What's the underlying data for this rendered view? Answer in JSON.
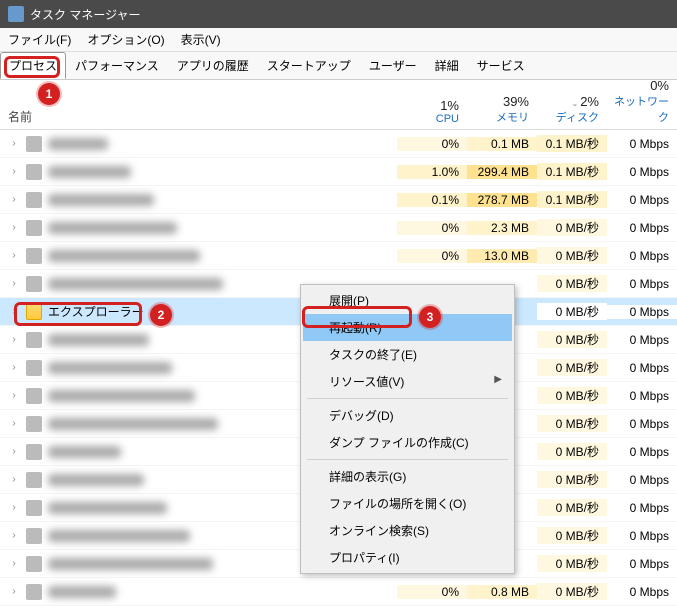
{
  "titlebar": {
    "title": "タスク マネージャー"
  },
  "menubar": {
    "file": "ファイル(F)",
    "options": "オプション(O)",
    "view": "表示(V)"
  },
  "tabs": {
    "processes": "プロセス",
    "performance": "パフォーマンス",
    "appHistory": "アプリの履歴",
    "startup": "スタートアップ",
    "users": "ユーザー",
    "details": "詳細",
    "services": "サービス"
  },
  "headers": {
    "name": "名前",
    "cpu": {
      "pct": "1%",
      "label": "CPU"
    },
    "memory": {
      "pct": "39%",
      "label": "メモリ"
    },
    "disk": {
      "pct": "2%",
      "label": "ディスク"
    },
    "network": {
      "pct": "0%",
      "label": "ネットワーク"
    }
  },
  "rows": [
    {
      "name": "",
      "cpu": "0%",
      "mem": "0.1 MB",
      "disk": "0.1 MB/秒",
      "net": "0 Mbps",
      "h": [
        "heat1",
        "heat2",
        "heat2",
        "heat0"
      ]
    },
    {
      "name": "",
      "cpu": "1.0%",
      "mem": "299.4 MB",
      "disk": "0.1 MB/秒",
      "net": "0 Mbps",
      "h": [
        "heat2",
        "heat4",
        "heat2",
        "heat0"
      ]
    },
    {
      "name": "",
      "cpu": "0.1%",
      "mem": "278.7 MB",
      "disk": "0.1 MB/秒",
      "net": "0 Mbps",
      "h": [
        "heat2",
        "heat4",
        "heat2",
        "heat0"
      ]
    },
    {
      "name": "",
      "cpu": "0%",
      "mem": "2.3 MB",
      "disk": "0 MB/秒",
      "net": "0 Mbps",
      "h": [
        "heat1",
        "heat2",
        "heat1",
        "heat0"
      ]
    },
    {
      "name": "",
      "cpu": "0%",
      "mem": "13.0 MB",
      "disk": "0 MB/秒",
      "net": "0 Mbps",
      "h": [
        "heat1",
        "heat3",
        "heat1",
        "heat0"
      ]
    },
    {
      "name": "",
      "cpu": "",
      "mem": "",
      "disk": "0 MB/秒",
      "net": "0 Mbps",
      "h": [
        "heat0",
        "heat0",
        "heat1",
        "heat0"
      ]
    },
    {
      "name": "エクスプローラー",
      "cpu": "",
      "mem": "",
      "disk": "0 MB/秒",
      "net": "0 Mbps",
      "selected": true,
      "h": [
        "heat0",
        "heat0",
        "heat0",
        "heat0"
      ]
    },
    {
      "name": "",
      "cpu": "",
      "mem": "",
      "disk": "0 MB/秒",
      "net": "0 Mbps",
      "h": [
        "heat0",
        "heat0",
        "heat1",
        "heat0"
      ]
    },
    {
      "name": "",
      "cpu": "",
      "mem": "",
      "disk": "0 MB/秒",
      "net": "0 Mbps",
      "h": [
        "heat0",
        "heat0",
        "heat1",
        "heat0"
      ]
    },
    {
      "name": "",
      "cpu": "",
      "mem": "",
      "disk": "0 MB/秒",
      "net": "0 Mbps",
      "h": [
        "heat0",
        "heat0",
        "heat1",
        "heat0"
      ]
    },
    {
      "name": "",
      "cpu": "",
      "mem": "",
      "disk": "0 MB/秒",
      "net": "0 Mbps",
      "h": [
        "heat0",
        "heat0",
        "heat1",
        "heat0"
      ]
    },
    {
      "name": "",
      "cpu": "",
      "mem": "",
      "disk": "0 MB/秒",
      "net": "0 Mbps",
      "h": [
        "heat0",
        "heat0",
        "heat1",
        "heat0"
      ]
    },
    {
      "name": "",
      "cpu": "",
      "mem": "",
      "disk": "0 MB/秒",
      "net": "0 Mbps",
      "h": [
        "heat0",
        "heat0",
        "heat1",
        "heat0"
      ]
    },
    {
      "name": "",
      "cpu": "",
      "mem": "",
      "disk": "0 MB/秒",
      "net": "0 Mbps",
      "h": [
        "heat0",
        "heat0",
        "heat1",
        "heat0"
      ]
    },
    {
      "name": "",
      "cpu": "",
      "mem": "",
      "disk": "0 MB/秒",
      "net": "0 Mbps",
      "h": [
        "heat0",
        "heat0",
        "heat1",
        "heat0"
      ]
    },
    {
      "name": "",
      "cpu": "",
      "mem": "",
      "disk": "0 MB/秒",
      "net": "0 Mbps",
      "h": [
        "heat0",
        "heat0",
        "heat1",
        "heat0"
      ]
    },
    {
      "name": "",
      "cpu": "0%",
      "mem": "0.8 MB",
      "disk": "0 MB/秒",
      "net": "0 Mbps",
      "h": [
        "heat1",
        "heat2",
        "heat1",
        "heat0"
      ]
    }
  ],
  "contextMenu": {
    "expand": "展開(P)",
    "restart": "再起動(R)",
    "endTask": "タスクの終了(E)",
    "resourceValues": "リソース値(V)",
    "debug": "デバッグ(D)",
    "createDump": "ダンプ ファイルの作成(C)",
    "showDetails": "詳細の表示(G)",
    "openLocation": "ファイルの場所を開く(O)",
    "searchOnline": "オンライン検索(S)",
    "properties": "プロパティ(I)"
  },
  "markers": {
    "m1": "1",
    "m2": "2",
    "m3": "3"
  }
}
